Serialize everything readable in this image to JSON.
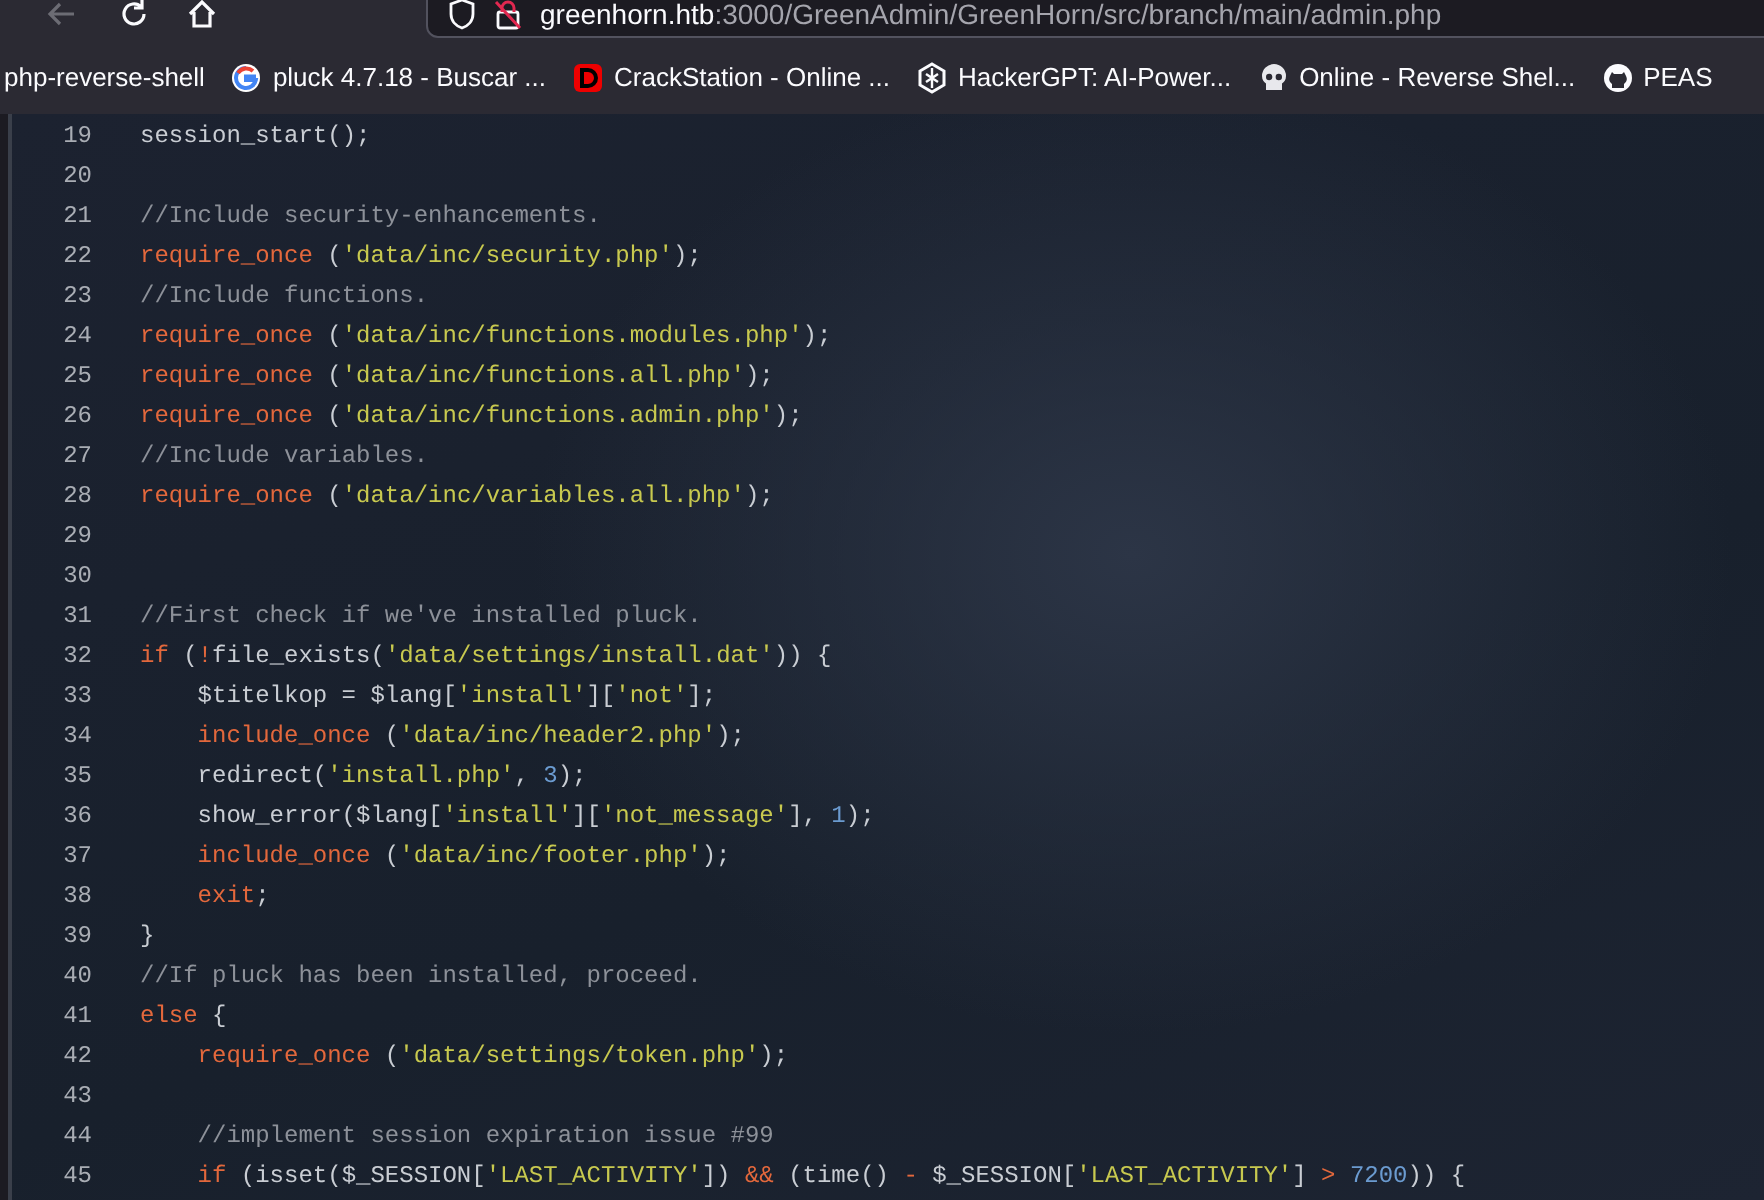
{
  "browser": {
    "url_host": "greenhorn.htb",
    "url_path": ":3000/GreenAdmin/GreenHorn/src/branch/main/admin.php"
  },
  "bookmarks": [
    {
      "label": "php-reverse-shell",
      "kind": "none"
    },
    {
      "label": "pluck 4.7.18 - Buscar ...",
      "kind": "google"
    },
    {
      "label": "CrackStation - Online ...",
      "kind": "letter"
    },
    {
      "label": "HackerGPT: AI-Power...",
      "kind": "emblem"
    },
    {
      "label": "Online - Reverse Shel...",
      "kind": "skull"
    },
    {
      "label": "PEAS",
      "kind": "github"
    }
  ],
  "code_lines": [
    {
      "number": "19",
      "indented": false,
      "tokens": [
        {
          "kind": "plain",
          "text": "session_start();"
        }
      ]
    },
    {
      "number": "20"
    },
    {
      "number": "21",
      "indented": false,
      "tokens": [
        {
          "kind": "comment",
          "text": "//Include security-enhancements."
        }
      ]
    },
    {
      "number": "22",
      "indented": false,
      "tokens": [
        {
          "kind": "keyword",
          "text": "require_once"
        },
        {
          "kind": "plain",
          "text": " ("
        },
        {
          "kind": "string",
          "text": "'data/inc/security.php'"
        },
        {
          "kind": "plain",
          "text": ");"
        }
      ]
    },
    {
      "number": "23",
      "indented": false,
      "tokens": [
        {
          "kind": "comment",
          "text": "//Include functions."
        }
      ]
    },
    {
      "number": "24",
      "indented": false,
      "tokens": [
        {
          "kind": "keyword",
          "text": "require_once"
        },
        {
          "kind": "plain",
          "text": " ("
        },
        {
          "kind": "string",
          "text": "'data/inc/functions.modules.php'"
        },
        {
          "kind": "plain",
          "text": ");"
        }
      ]
    },
    {
      "number": "25",
      "indented": false,
      "tokens": [
        {
          "kind": "keyword",
          "text": "require_once"
        },
        {
          "kind": "plain",
          "text": " ("
        },
        {
          "kind": "string",
          "text": "'data/inc/functions.all.php'"
        },
        {
          "kind": "plain",
          "text": ");"
        }
      ]
    },
    {
      "number": "26",
      "indented": false,
      "tokens": [
        {
          "kind": "keyword",
          "text": "require_once"
        },
        {
          "kind": "plain",
          "text": " ("
        },
        {
          "kind": "string",
          "text": "'data/inc/functions.admin.php'"
        },
        {
          "kind": "plain",
          "text": ");"
        }
      ]
    },
    {
      "number": "27",
      "indented": false,
      "tokens": [
        {
          "kind": "comment",
          "text": "//Include variables."
        }
      ]
    },
    {
      "number": "28",
      "indented": false,
      "tokens": [
        {
          "kind": "keyword",
          "text": "require_once"
        },
        {
          "kind": "plain",
          "text": " ("
        },
        {
          "kind": "string",
          "text": "'data/inc/variables.all.php'"
        },
        {
          "kind": "plain",
          "text": ");"
        }
      ]
    },
    {
      "number": "29"
    },
    {
      "number": "30"
    },
    {
      "number": "31",
      "indented": false,
      "tokens": [
        {
          "kind": "comment",
          "text": "//First check if we've installed pluck."
        }
      ]
    },
    {
      "number": "32",
      "indented": false,
      "tokens": [
        {
          "kind": "keyword",
          "text": "if"
        },
        {
          "kind": "plain",
          "text": " ("
        },
        {
          "kind": "keyword",
          "text": "!"
        },
        {
          "kind": "plain",
          "text": "file_exists("
        },
        {
          "kind": "string",
          "text": "'data/settings/install.dat'"
        },
        {
          "kind": "plain",
          "text": ")) {"
        }
      ]
    },
    {
      "number": "33",
      "indented": true,
      "tokens": [
        {
          "kind": "plain",
          "text": "$titelkop = $lang["
        },
        {
          "kind": "string",
          "text": "'install'"
        },
        {
          "kind": "plain",
          "text": "]["
        },
        {
          "kind": "string",
          "text": "'not'"
        },
        {
          "kind": "plain",
          "text": "];"
        }
      ]
    },
    {
      "number": "34",
      "indented": true,
      "tokens": [
        {
          "kind": "keyword",
          "text": "include_once"
        },
        {
          "kind": "plain",
          "text": " ("
        },
        {
          "kind": "string",
          "text": "'data/inc/header2.php'"
        },
        {
          "kind": "plain",
          "text": ");"
        }
      ]
    },
    {
      "number": "35",
      "indented": true,
      "tokens": [
        {
          "kind": "plain",
          "text": "redirect("
        },
        {
          "kind": "string",
          "text": "'install.php'"
        },
        {
          "kind": "plain",
          "text": ", "
        },
        {
          "kind": "number",
          "text": "3"
        },
        {
          "kind": "plain",
          "text": ");"
        }
      ]
    },
    {
      "number": "36",
      "indented": true,
      "tokens": [
        {
          "kind": "plain",
          "text": "show_error($lang["
        },
        {
          "kind": "string",
          "text": "'install'"
        },
        {
          "kind": "plain",
          "text": "]["
        },
        {
          "kind": "string",
          "text": "'not_message'"
        },
        {
          "kind": "plain",
          "text": "], "
        },
        {
          "kind": "number",
          "text": "1"
        },
        {
          "kind": "plain",
          "text": ");"
        }
      ]
    },
    {
      "number": "37",
      "indented": true,
      "tokens": [
        {
          "kind": "keyword",
          "text": "include_once"
        },
        {
          "kind": "plain",
          "text": " ("
        },
        {
          "kind": "string",
          "text": "'data/inc/footer.php'"
        },
        {
          "kind": "plain",
          "text": ");"
        }
      ]
    },
    {
      "number": "38",
      "indented": true,
      "tokens": [
        {
          "kind": "keyword",
          "text": "exit"
        },
        {
          "kind": "plain",
          "text": ";"
        }
      ]
    },
    {
      "number": "39",
      "indented": false,
      "tokens": [
        {
          "kind": "plain",
          "text": "}"
        }
      ]
    },
    {
      "number": "40",
      "indented": false,
      "tokens": [
        {
          "kind": "comment",
          "text": "//If pluck has been installed, proceed."
        }
      ]
    },
    {
      "number": "41",
      "indented": false,
      "tokens": [
        {
          "kind": "keyword",
          "text": "else"
        },
        {
          "kind": "plain",
          "text": " {"
        }
      ]
    },
    {
      "number": "42",
      "indented": true,
      "tokens": [
        {
          "kind": "keyword",
          "text": "require_once"
        },
        {
          "kind": "plain",
          "text": " ("
        },
        {
          "kind": "string",
          "text": "'data/settings/token.php'"
        },
        {
          "kind": "plain",
          "text": ");"
        }
      ]
    },
    {
      "number": "43"
    },
    {
      "number": "44",
      "indented": true,
      "tokens": [
        {
          "kind": "comment",
          "text": "//implement session expiration issue #99"
        }
      ]
    },
    {
      "number": "45",
      "indented": true,
      "tokens": [
        {
          "kind": "keyword",
          "text": "if"
        },
        {
          "kind": "plain",
          "text": " (isset($_SESSION["
        },
        {
          "kind": "string",
          "text": "'LAST_ACTIVITY'"
        },
        {
          "kind": "plain",
          "text": "]) "
        },
        {
          "kind": "keyword",
          "text": "&&"
        },
        {
          "kind": "plain",
          "text": " (time() "
        },
        {
          "kind": "keyword",
          "text": "-"
        },
        {
          "kind": "plain",
          "text": " $_SESSION["
        },
        {
          "kind": "string",
          "text": "'LAST_ACTIVITY'"
        },
        {
          "kind": "plain",
          "text": "] "
        },
        {
          "kind": "keyword",
          "text": ">"
        },
        {
          "kind": "number",
          "text": " 7200"
        },
        {
          "kind": "plain",
          "text": ")) {"
        }
      ]
    }
  ]
}
